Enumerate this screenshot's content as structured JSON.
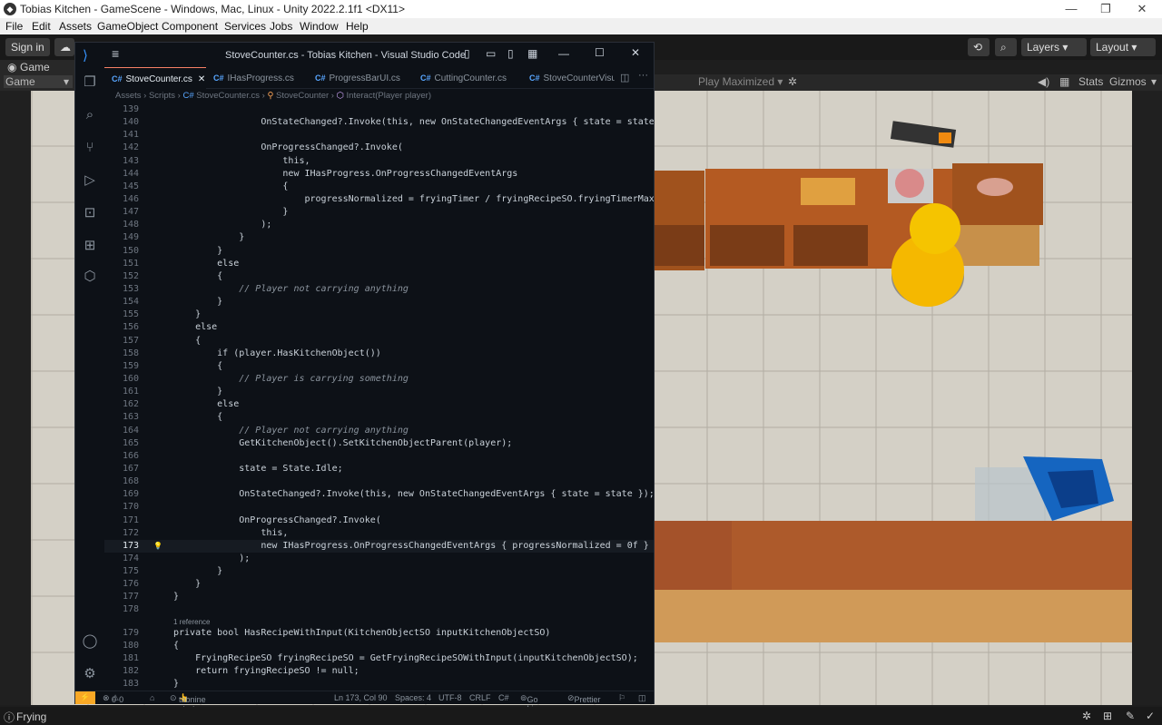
{
  "unity": {
    "title": "Tobias Kitchen - GameScene - Windows, Mac, Linux - Unity 2022.2.1f1 <DX11>",
    "menu": [
      "File",
      "Edit",
      "Assets",
      "GameObject",
      "Component",
      "Services",
      "Jobs",
      "Window",
      "Help"
    ],
    "sign_in": "Sign in",
    "layers": "Layers",
    "layout": "Layout",
    "game_tab": "Game",
    "game_dropdown": "Game",
    "play_maximized": "Play Maximized",
    "stats": "Stats",
    "gizmos": "Gizmos",
    "status_text": "Frying"
  },
  "vscode": {
    "title": "StoveCounter.cs - Tobias Kitchen - Visual Studio Code",
    "tabs": [
      "StoveCounter.cs",
      "IHasProgress.cs",
      "ProgressBarUI.cs",
      "CuttingCounter.cs",
      "StoveCounterVisu"
    ],
    "breadcrumb": [
      "Assets",
      "Scripts",
      "StoveCounter.cs",
      "StoveCounter",
      "Interact(Player player)"
    ],
    "codelens": "1 reference",
    "status": {
      "errors": "0",
      "warnings": "0",
      "tabnine": "tabnine starter",
      "position": "Ln 173, Col 90",
      "spaces": "Spaces: 4",
      "encoding": "UTF-8",
      "eol": "CRLF",
      "language": "C#",
      "golive": "Go Live",
      "prettier": "Prettier"
    }
  },
  "code_lines": [
    {
      "n": "139",
      "t": ""
    },
    {
      "n": "140",
      "t": "                OnStateChanged?.Invoke(this, new OnStateChangedEventArgs { state = state });"
    },
    {
      "n": "141",
      "t": ""
    },
    {
      "n": "142",
      "t": "                OnProgressChanged?.Invoke("
    },
    {
      "n": "143",
      "t": "                    this,"
    },
    {
      "n": "144",
      "t": "                    new IHasProgress.OnProgressChangedEventArgs"
    },
    {
      "n": "145",
      "t": "                    {"
    },
    {
      "n": "146",
      "t": "                        progressNormalized = fryingTimer / fryingRecipeSO.fryingTimerMax"
    },
    {
      "n": "147",
      "t": "                    }"
    },
    {
      "n": "148",
      "t": "                );"
    },
    {
      "n": "149",
      "t": "            }"
    },
    {
      "n": "150",
      "t": "        }"
    },
    {
      "n": "151",
      "t": "        else"
    },
    {
      "n": "152",
      "t": "        {"
    },
    {
      "n": "153",
      "t": "            // Player not carrying anything"
    },
    {
      "n": "154",
      "t": "        }"
    },
    {
      "n": "155",
      "t": "    }"
    },
    {
      "n": "156",
      "t": "    else"
    },
    {
      "n": "157",
      "t": "    {"
    },
    {
      "n": "158",
      "t": "        if (player.HasKitchenObject())"
    },
    {
      "n": "159",
      "t": "        {"
    },
    {
      "n": "160",
      "t": "            // Player is carrying something"
    },
    {
      "n": "161",
      "t": "        }"
    },
    {
      "n": "162",
      "t": "        else"
    },
    {
      "n": "163",
      "t": "        {"
    },
    {
      "n": "164",
      "t": "            // Player not carrying anything"
    },
    {
      "n": "165",
      "t": "            GetKitchenObject().SetKitchenObjectParent(player);"
    },
    {
      "n": "166",
      "t": ""
    },
    {
      "n": "167",
      "t": "            state = State.Idle;"
    },
    {
      "n": "168",
      "t": ""
    },
    {
      "n": "169",
      "t": "            OnStateChanged?.Invoke(this, new OnStateChangedEventArgs { state = state });"
    },
    {
      "n": "170",
      "t": ""
    },
    {
      "n": "171",
      "t": "            OnProgressChanged?.Invoke("
    },
    {
      "n": "172",
      "t": "                this,"
    },
    {
      "n": "173",
      "t": "                new IHasProgress.OnProgressChangedEventArgs { progressNormalized = 0f }"
    },
    {
      "n": "174",
      "t": "            );"
    },
    {
      "n": "175",
      "t": "        }"
    },
    {
      "n": "176",
      "t": "    }"
    },
    {
      "n": "177",
      "t": "}"
    },
    {
      "n": "178",
      "t": ""
    },
    {
      "n": "179",
      "t": "private bool HasRecipeWithInput(KitchenObjectSO inputKitchenObjectSO)"
    },
    {
      "n": "180",
      "t": "{"
    },
    {
      "n": "181",
      "t": "    FryingRecipeSO fryingRecipeSO = GetFryingRecipeSOWithInput(inputKitchenObjectSO);"
    },
    {
      "n": "182",
      "t": "    return fryingRecipeSO != null;"
    },
    {
      "n": "183",
      "t": "}"
    }
  ],
  "colors": {
    "editor_bg": "#0d1117",
    "accent_tab": "#f78166",
    "status_bar_accent": "#f9a825"
  }
}
